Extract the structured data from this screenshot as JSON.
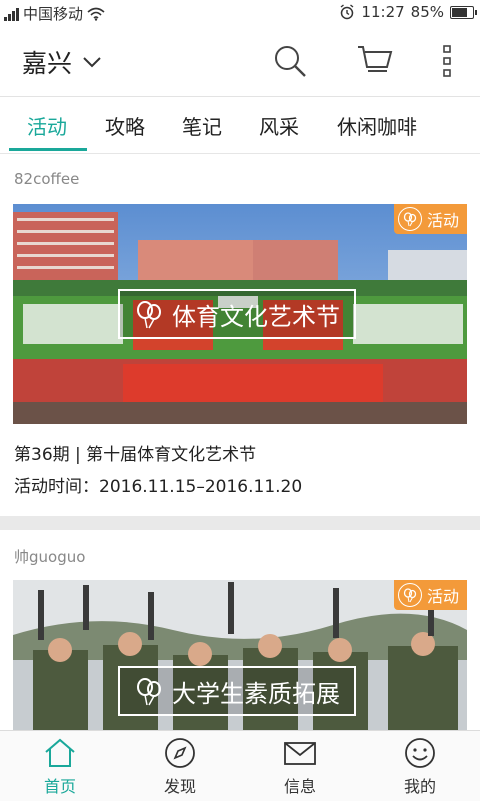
{
  "status_bar": {
    "carrier": "中国移动",
    "time": "11:27",
    "battery": "85%",
    "battery_level": 0.85
  },
  "header": {
    "city": "嘉兴"
  },
  "tabs": [
    {
      "label": "活动",
      "active": true
    },
    {
      "label": "攻略",
      "active": false
    },
    {
      "label": "笔记",
      "active": false
    },
    {
      "label": "风采",
      "active": false
    },
    {
      "label": "休闲咖啡",
      "active": false
    }
  ],
  "feed": [
    {
      "author": "82coffee",
      "badge": "活动",
      "overlay_title": "体育文化艺术节",
      "title": "第36期 | 第十届体育文化艺术节",
      "time": "活动时间：2016.11.15–2016.11.20"
    },
    {
      "author": "帅guoguo",
      "badge": "活动",
      "overlay_title": "大学生素质拓展"
    }
  ],
  "bottom_nav": [
    {
      "label": "首页",
      "icon": "home-icon",
      "active": true
    },
    {
      "label": "发现",
      "icon": "compass-icon",
      "active": false
    },
    {
      "label": "信息",
      "icon": "mail-icon",
      "active": false
    },
    {
      "label": "我的",
      "icon": "smiley-icon",
      "active": false
    }
  ],
  "colors": {
    "accent": "#1aa89a",
    "badge": "#f39a3a"
  }
}
